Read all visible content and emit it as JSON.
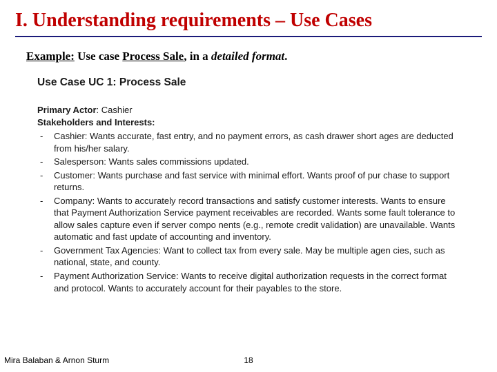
{
  "title": "I. Understanding requirements – Use Cases",
  "example": {
    "prefix": "Example:",
    "mid1": " Use case ",
    "usecase": "Process Sale",
    "mid2": ", in a ",
    "format": "detailed format",
    "suffix": "."
  },
  "uc": {
    "heading": "Use Case UC 1: Process Sale",
    "primary_actor_label": "Primary Actor",
    "primary_actor_value": ": Cashier",
    "stakeholders_label": "Stakeholders and Interests:",
    "items": [
      "Cashier: Wants accurate, fast entry, and no payment errors, as cash drawer short ages are deducted from his/her salary.",
      "Salesperson: Wants sales commissions updated.",
      "Customer: Wants purchase and fast service with minimal effort. Wants proof of pur chase to support returns.",
      "Company: Wants to accurately record transactions and satisfy customer interests. Wants to ensure that Payment Authorization Service payment receivables are recorded. Wants some fault tolerance to allow sales capture even if server compo nents (e.g., remote credit validation) are unavailable. Wants automatic and fast update of accounting and inventory.",
      "Government Tax Agencies: Want to collect tax from every sale. May be multiple agen cies, such as national, state, and county.",
      "Payment Authorization Service: Wants to receive digital authorization requests in the correct format and protocol. Wants to accurately account for their payables to the store."
    ]
  },
  "footer": {
    "authors": "Mira Balaban  &  Arnon Sturm",
    "page": "18"
  }
}
